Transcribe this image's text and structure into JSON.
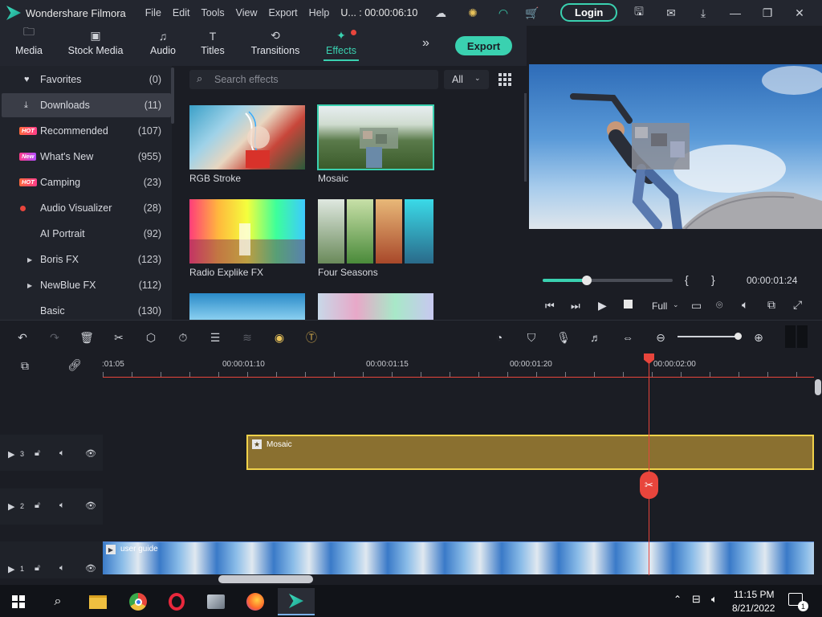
{
  "app": {
    "name": "Wondershare Filmora",
    "project": "U... : 00:00:06:10"
  },
  "menu": [
    "File",
    "Edit",
    "Tools",
    "View",
    "Export",
    "Help"
  ],
  "login_label": "Login",
  "tabs": [
    {
      "label": "Media",
      "icon": "folder-icon"
    },
    {
      "label": "Stock Media",
      "icon": "stock-media-icon"
    },
    {
      "label": "Audio",
      "icon": "music-note-icon"
    },
    {
      "label": "Titles",
      "icon": "titles-icon"
    },
    {
      "label": "Transitions",
      "icon": "transitions-icon"
    },
    {
      "label": "Effects",
      "icon": "effects-icon",
      "active": true
    }
  ],
  "export_label": "Export",
  "sidebar": [
    {
      "label": "Favorites",
      "count": "(0)"
    },
    {
      "label": "Downloads",
      "count": "(11)",
      "selected": true
    },
    {
      "label": "Recommended",
      "count": "(107)",
      "badge": "HOT"
    },
    {
      "label": "What's New",
      "count": "(955)",
      "badge": "New"
    },
    {
      "label": "Camping",
      "count": "(23)",
      "badge": "HOT"
    },
    {
      "label": "Audio Visualizer",
      "count": "(28)"
    },
    {
      "label": "AI Portrait",
      "count": "(92)"
    },
    {
      "label": "Boris FX",
      "count": "(123)"
    },
    {
      "label": "NewBlue FX",
      "count": "(112)"
    },
    {
      "label": "Basic",
      "count": "(130)"
    }
  ],
  "search": {
    "placeholder": "Search effects",
    "filter": "All"
  },
  "effects": [
    {
      "label": "RGB Stroke"
    },
    {
      "label": "Mosaic"
    },
    {
      "label": "Radio Explike FX"
    },
    {
      "label": "Four Seasons"
    }
  ],
  "player": {
    "time": "00:00:01:24",
    "quality": "Full",
    "progress": 0.34,
    "mark_in": "{",
    "mark_out": "}"
  },
  "ruler": [
    ":01:05",
    "00:00:01:10",
    "00:00:01:15",
    "00:00:01:20",
    "00:00:02:00"
  ],
  "tracks": [
    {
      "num": "3",
      "clip": "Mosaic"
    },
    {
      "num": "2",
      "clip": ""
    },
    {
      "num": "1",
      "clip": "user guide"
    }
  ],
  "taskbar": {
    "time": "11:15 PM",
    "date": "8/21/2022",
    "notifications": "1"
  },
  "colors": {
    "accent": "#3ad1b0",
    "playhead": "#e8453c",
    "effect_clip": "#8a7030"
  }
}
